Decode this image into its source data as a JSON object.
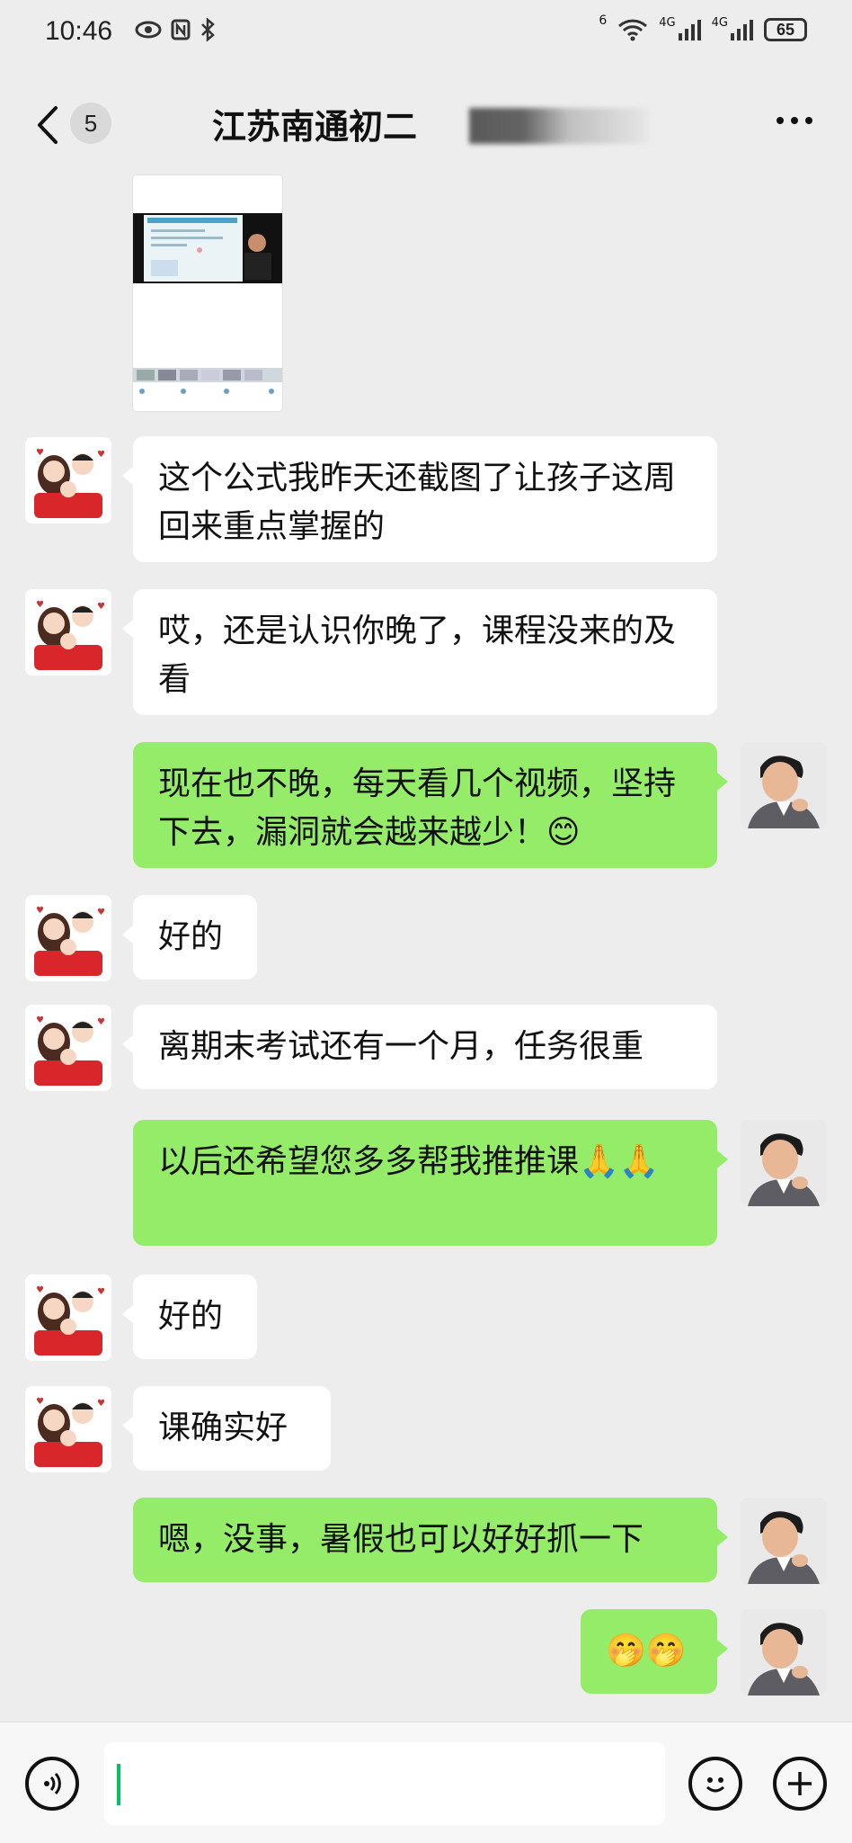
{
  "status_bar": {
    "time": "10:46",
    "network_left": "6",
    "signal1": "4G",
    "signal2": "4G",
    "battery": "65"
  },
  "nav": {
    "unread_count": "5",
    "title": "江苏南通初二"
  },
  "messages": [
    {
      "side": "in",
      "text": "这个公式我昨天还截图了让孩子这周回来重点掌握的"
    },
    {
      "side": "in",
      "text": "哎，还是认识你晚了，课程没来的及看"
    },
    {
      "side": "out",
      "text": "现在也不晚，每天看几个视频，坚持下去，漏洞就会越来越少！😊"
    },
    {
      "side": "in",
      "text": "好的"
    },
    {
      "side": "in",
      "text": "离期末考试还有一个月，任务很重"
    },
    {
      "side": "out",
      "text": "以后还希望您多多帮我推推课🙏🙏"
    },
    {
      "side": "in",
      "text": "好的"
    },
    {
      "side": "in",
      "text": "课确实好"
    },
    {
      "side": "out",
      "text": "嗯，没事，暑假也可以好好抓一下"
    },
    {
      "side": "out",
      "text": "🤭🤭"
    }
  ],
  "colors": {
    "background": "#ededed",
    "outgoing_bubble": "#95ec69",
    "incoming_bubble": "#ffffff",
    "caret": "#07c160"
  },
  "icons": [
    "back-arrow-icon",
    "more-dots-icon",
    "voice-icon",
    "emoji-icon",
    "plus-icon"
  ]
}
